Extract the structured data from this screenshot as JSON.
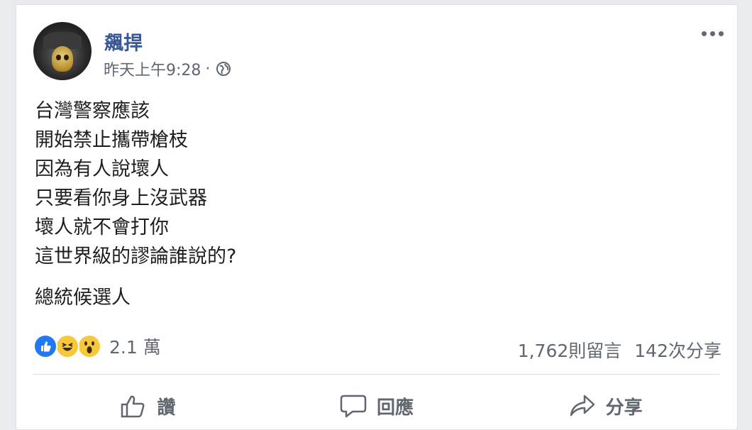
{
  "post": {
    "author": "飆捍",
    "timestamp": "昨天上午9:28",
    "separator": "·",
    "privacy_icon": "globe-icon",
    "lines": [
      "台灣警察應該",
      "開始禁止攜帶槍枝",
      "因為有人說壞人",
      "只要看你身上沒武器",
      "壞人就不會打你",
      "這世界級的謬論誰說的?"
    ],
    "footer_line": "總統候選人"
  },
  "engagement": {
    "reaction_icons": [
      "like-icon",
      "haha-icon",
      "wow-icon"
    ],
    "reaction_count": "2.1 萬",
    "comments": "1,762則留言",
    "shares": "142次分享"
  },
  "actions": {
    "like_label": "讚",
    "comment_label": "回應",
    "share_label": "分享"
  },
  "colors": {
    "author": "#385898",
    "secondary_text": "#606770",
    "like_blue": "#2078f4",
    "emoji_yellow": "#f7c83b"
  }
}
